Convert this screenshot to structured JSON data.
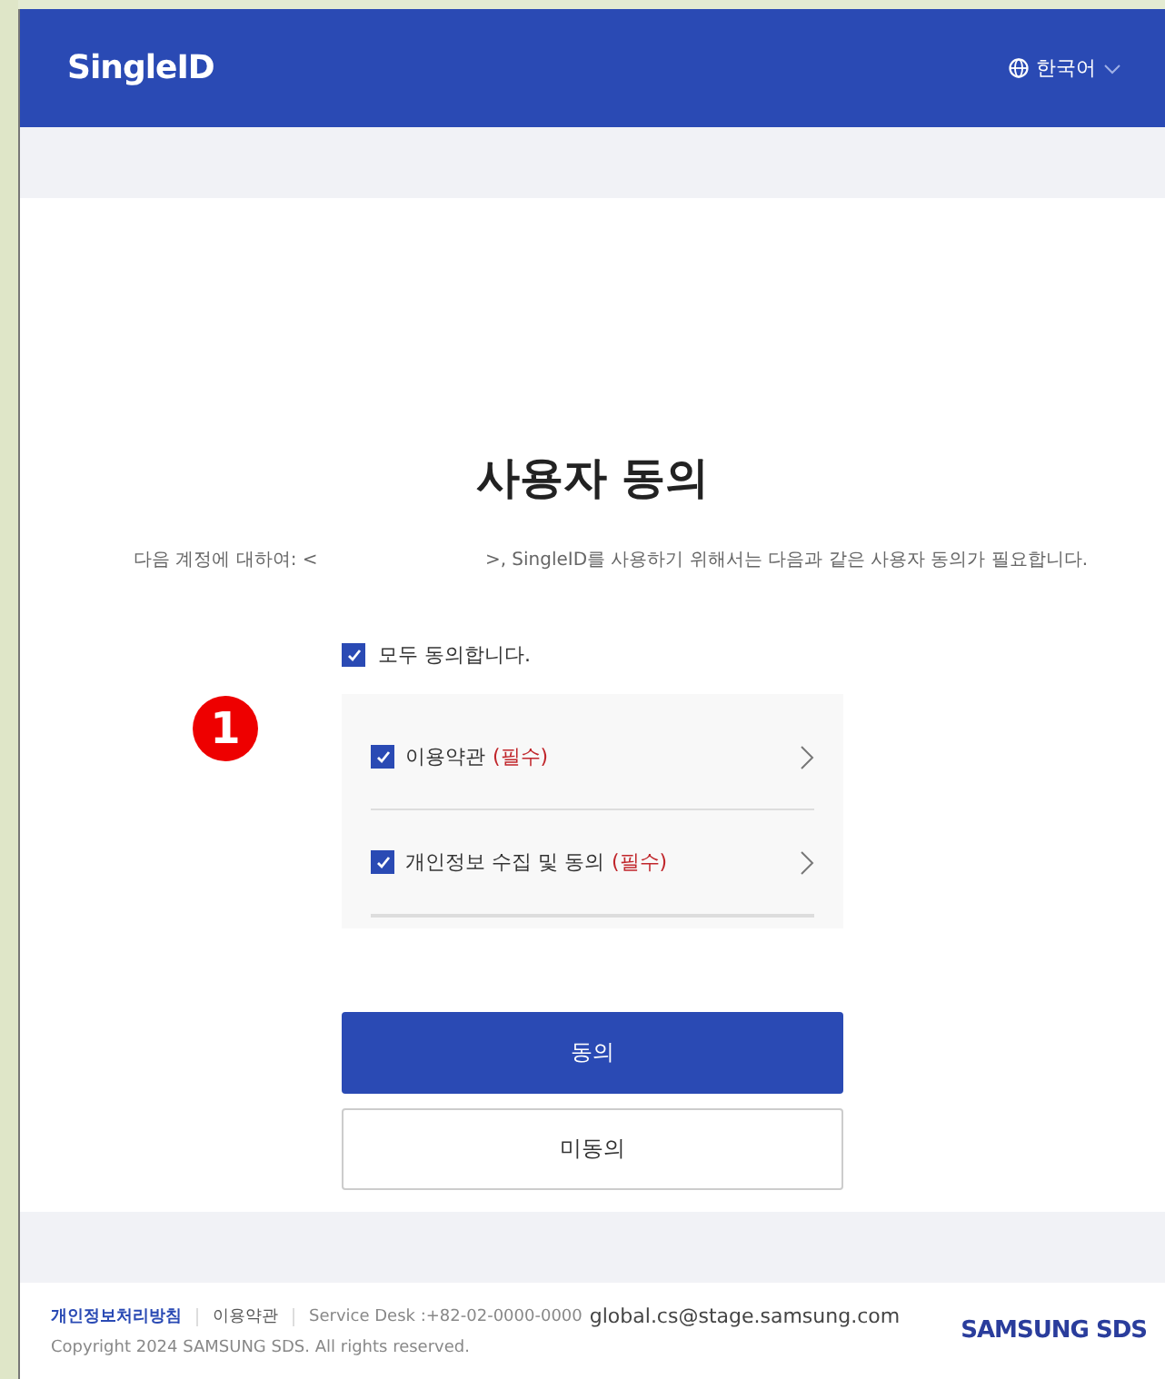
{
  "header": {
    "logo": "SingleID",
    "language": "한국어"
  },
  "page": {
    "title": "사용자 동의",
    "account_prefix": "다음 계정에 대하여: <",
    "account_suffix": ">, SingleID를 사용하기 위해서는 다음과 같은 사용자 동의가 필요합니다."
  },
  "agree_all": {
    "label": "모두 동의합니다.",
    "checked": true
  },
  "annotation": "1",
  "consents": [
    {
      "label": "이용약관",
      "required": "(필수)",
      "checked": true
    },
    {
      "label": "개인정보 수집 및 동의",
      "required": "(필수)",
      "checked": true
    }
  ],
  "buttons": {
    "agree": "동의",
    "disagree": "미동의"
  },
  "footer": {
    "links": [
      "개인정보처리방침",
      "이용약관"
    ],
    "service_desk": "Service Desk :+82-02-0000-0000",
    "email": "global.cs@stage.samsung.com",
    "copyright": "Copyright 2024 SAMSUNG SDS. All rights reserved.",
    "brand": "SAMSUNG SDS"
  }
}
